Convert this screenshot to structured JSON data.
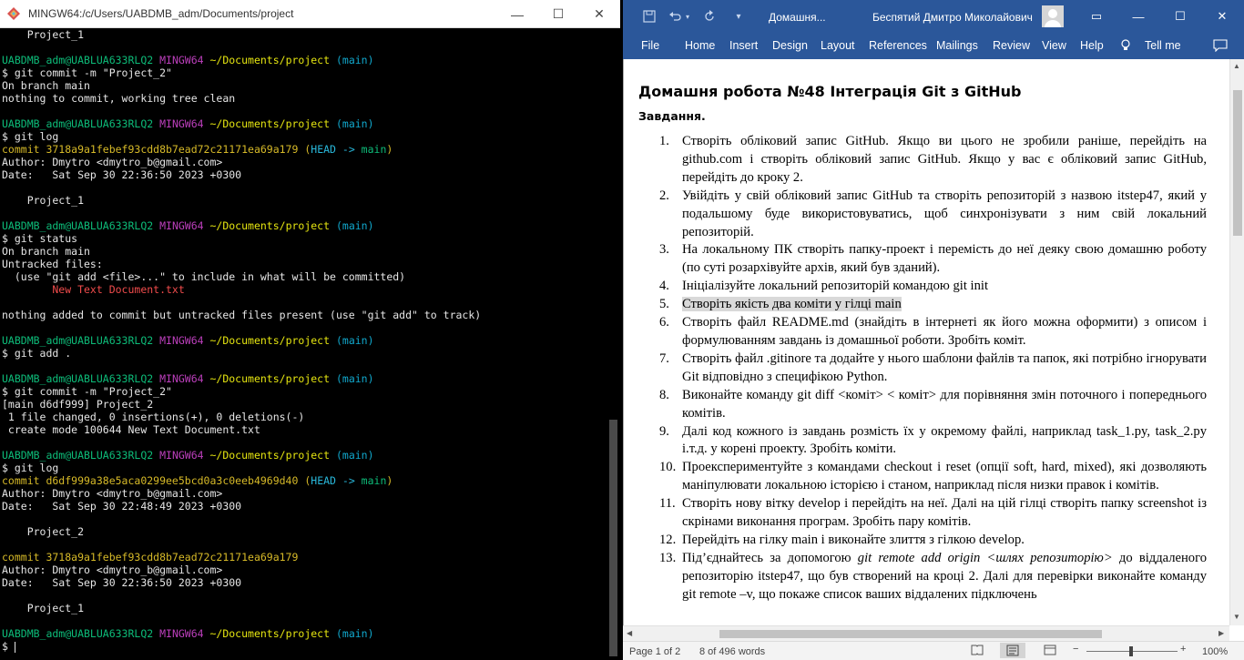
{
  "terminal": {
    "title": "MINGW64:/c/Users/UABDMB_adm/Documents/project",
    "lines": [
      [
        {
          "t": "    Project_1"
        }
      ],
      [
        {
          "t": ""
        }
      ],
      [
        {
          "t": "UABDMB_adm@UABLUA633RLQ2 ",
          "c": "c-green"
        },
        {
          "t": "MINGW64 ",
          "c": "c-mag"
        },
        {
          "t": "~/Documents/project ",
          "c": "c-yel"
        },
        {
          "t": "(main)",
          "c": "c-cyan"
        }
      ],
      [
        {
          "t": "$ git commit -m \"Project_2\""
        }
      ],
      [
        {
          "t": "On branch main"
        }
      ],
      [
        {
          "t": "nothing to commit, working tree clean"
        }
      ],
      [
        {
          "t": ""
        }
      ],
      [
        {
          "t": "UABDMB_adm@UABLUA633RLQ2 ",
          "c": "c-green"
        },
        {
          "t": "MINGW64 ",
          "c": "c-mag"
        },
        {
          "t": "~/Documents/project ",
          "c": "c-yel"
        },
        {
          "t": "(main)",
          "c": "c-cyan"
        }
      ],
      [
        {
          "t": "$ git log"
        }
      ],
      [
        {
          "t": "commit 3718a9a1febef93cdd8b7ead72c21171ea69a179 ",
          "c": "c-gold"
        },
        {
          "t": "(",
          "c": "c-gold"
        },
        {
          "t": "HEAD -> ",
          "c": "c-bcyan"
        },
        {
          "t": "main",
          "c": "c-green"
        },
        {
          "t": ")",
          "c": "c-gold"
        }
      ],
      [
        {
          "t": "Author: Dmytro <dmytro_b@gmail.com>"
        }
      ],
      [
        {
          "t": "Date:   Sat Sep 30 22:36:50 2023 +0300"
        }
      ],
      [
        {
          "t": ""
        }
      ],
      [
        {
          "t": "    Project_1"
        }
      ],
      [
        {
          "t": ""
        }
      ],
      [
        {
          "t": "UABDMB_adm@UABLUA633RLQ2 ",
          "c": "c-green"
        },
        {
          "t": "MINGW64 ",
          "c": "c-mag"
        },
        {
          "t": "~/Documents/project ",
          "c": "c-yel"
        },
        {
          "t": "(main)",
          "c": "c-cyan"
        }
      ],
      [
        {
          "t": "$ git status"
        }
      ],
      [
        {
          "t": "On branch main"
        }
      ],
      [
        {
          "t": "Untracked files:"
        }
      ],
      [
        {
          "t": "  (use \"git add <file>...\" to include in what will be committed)"
        }
      ],
      [
        {
          "t": "        New Text Document.txt",
          "c": "c-red"
        }
      ],
      [
        {
          "t": ""
        }
      ],
      [
        {
          "t": "nothing added to commit but untracked files present (use \"git add\" to track)"
        }
      ],
      [
        {
          "t": ""
        }
      ],
      [
        {
          "t": "UABDMB_adm@UABLUA633RLQ2 ",
          "c": "c-green"
        },
        {
          "t": "MINGW64 ",
          "c": "c-mag"
        },
        {
          "t": "~/Documents/project ",
          "c": "c-yel"
        },
        {
          "t": "(main)",
          "c": "c-cyan"
        }
      ],
      [
        {
          "t": "$ git add ."
        }
      ],
      [
        {
          "t": ""
        }
      ],
      [
        {
          "t": "UABDMB_adm@UABLUA633RLQ2 ",
          "c": "c-green"
        },
        {
          "t": "MINGW64 ",
          "c": "c-mag"
        },
        {
          "t": "~/Documents/project ",
          "c": "c-yel"
        },
        {
          "t": "(main)",
          "c": "c-cyan"
        }
      ],
      [
        {
          "t": "$ git commit -m \"Project_2\""
        }
      ],
      [
        {
          "t": "[main d6df999] Project_2"
        }
      ],
      [
        {
          "t": " 1 file changed, 0 insertions(+), 0 deletions(-)"
        }
      ],
      [
        {
          "t": " create mode 100644 New Text Document.txt"
        }
      ],
      [
        {
          "t": ""
        }
      ],
      [
        {
          "t": "UABDMB_adm@UABLUA633RLQ2 ",
          "c": "c-green"
        },
        {
          "t": "MINGW64 ",
          "c": "c-mag"
        },
        {
          "t": "~/Documents/project ",
          "c": "c-yel"
        },
        {
          "t": "(main)",
          "c": "c-cyan"
        }
      ],
      [
        {
          "t": "$ git log"
        }
      ],
      [
        {
          "t": "commit d6df999a38e5aca0299ee5bcd0a3c0eeb4969d40 ",
          "c": "c-gold"
        },
        {
          "t": "(",
          "c": "c-gold"
        },
        {
          "t": "HEAD -> ",
          "c": "c-bcyan"
        },
        {
          "t": "main",
          "c": "c-green"
        },
        {
          "t": ")",
          "c": "c-gold"
        }
      ],
      [
        {
          "t": "Author: Dmytro <dmytro_b@gmail.com>"
        }
      ],
      [
        {
          "t": "Date:   Sat Sep 30 22:48:49 2023 +0300"
        }
      ],
      [
        {
          "t": ""
        }
      ],
      [
        {
          "t": "    Project_2"
        }
      ],
      [
        {
          "t": ""
        }
      ],
      [
        {
          "t": "commit 3718a9a1febef93cdd8b7ead72c21171ea69a179",
          "c": "c-gold"
        }
      ],
      [
        {
          "t": "Author: Dmytro <dmytro_b@gmail.com>"
        }
      ],
      [
        {
          "t": "Date:   Sat Sep 30 22:36:50 2023 +0300"
        }
      ],
      [
        {
          "t": ""
        }
      ],
      [
        {
          "t": "    Project_1"
        }
      ],
      [
        {
          "t": ""
        }
      ],
      [
        {
          "t": "UABDMB_adm@UABLUA633RLQ2 ",
          "c": "c-green"
        },
        {
          "t": "MINGW64 ",
          "c": "c-mag"
        },
        {
          "t": "~/Documents/project ",
          "c": "c-yel"
        },
        {
          "t": "(main)",
          "c": "c-cyan"
        }
      ],
      [
        {
          "t": "$ "
        }
      ]
    ],
    "controls": {
      "minimize": "—",
      "maximize": "☐",
      "close": "✕"
    }
  },
  "word": {
    "doc_title": "Домашня...",
    "user_name": "Беспятий Дмитро Миколайович",
    "quick_access": {
      "save_icon": "save-icon",
      "undo_icon": "undo-icon",
      "redo_icon": "redo-icon",
      "customize": "▾"
    },
    "controls": {
      "ribbon_display": "▭",
      "minimize": "—",
      "maximize": "☐",
      "close": "✕"
    },
    "tabs": [
      "File",
      "Home",
      "Insert",
      "Design",
      "Layout",
      "References",
      "Mailings",
      "Review",
      "View",
      "Help"
    ],
    "tell_me": "Tell me",
    "heading": "Домашня робота №48 Інтеграція Git з GitHub",
    "subheading": "Завдання.",
    "tasks": [
      {
        "num": "1.",
        "text": "Створіть обліковий запис GitHub. Якщо ви цього не зробили раніше, перейдіть на github.com і створіть обліковий запис GitHub. Якщо у вас є обліковий запис GitHub, перейдіть до кроку 2."
      },
      {
        "num": "2.",
        "text": "Увійдіть у свій обліковий запис GitHub та створіть репозиторій з назвою itstep47, який у подальшому буде використовуватись, щоб синхронізувати з ним свій локальний репозиторій."
      },
      {
        "num": "3.",
        "text": "На локальному ПК створіть папку-проект і перемість до неї деяку свою домашню роботу (по суті розархівуйте архів, який був зданий)."
      },
      {
        "num": "4.",
        "text": "Ініціалізуйте локальний репозиторій командою git init"
      },
      {
        "num": "5.",
        "text": "Створіть якість два коміти у гілці main",
        "highlight": true
      },
      {
        "num": "6.",
        "text": " Створіть файл README.md (знайдіть в інтернеті як його можна оформити) з описом і формулюванням завдань із домашньої роботи.  Зробіть коміт."
      },
      {
        "num": "7.",
        "text": "Створіть файл .gitinore та додайте у нього шаблони файлів та папок, які потрібно ігнорувати Git відповідно з специфікою Python."
      },
      {
        "num": "8.",
        "text": "Виконайте команду git diff  <коміт> < коміт> для порівняння змін поточного і попереднього комітів."
      },
      {
        "num": "9.",
        "text": "Далі код кожного із завдань розмість їх у окремому файлі, наприклад  task_1.py, task_2.py і.т.д. у корені проекту. Зробіть коміти."
      },
      {
        "num": "10.",
        "text": "Проекспериментуйте з командами checkout і reset (опції soft, hard, mixed), які дозволяють маніпулювати локальною історією і станом, наприклад після низки правок і комітів."
      },
      {
        "num": "11.",
        "text": "Створіть нову вітку develop і перейдіть на неї. Далі на цій гілці створіть папку screenshot із скрінами виконання програм. Зробіть пару комітів."
      },
      {
        "num": "12.",
        "text": "Перейдіть на гілку main і виконайте злиття з гілкою develop."
      },
      {
        "num": "13.",
        "pre": "Під’єднайтесь за допомогою ",
        "italic": "git remote add origin <шлях репозиторію>",
        "post": " до віддаленого репозиторію itstep47, що був створений на кроці 2. Далі для перевірки виконайте команду git remote –v, що покаже список ваших віддалених підключень"
      }
    ],
    "status": {
      "page": "Page 1 of 2",
      "words": "8 of 496 words",
      "zoom": "100%",
      "zoom_minus": "−",
      "zoom_plus": "+"
    }
  }
}
